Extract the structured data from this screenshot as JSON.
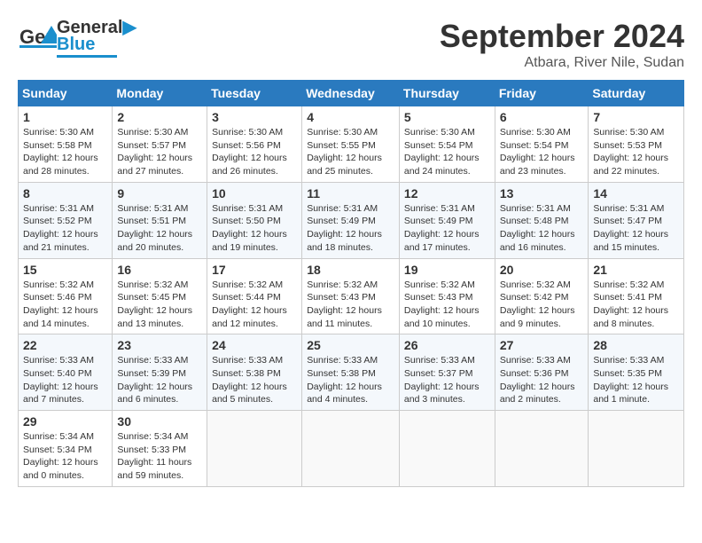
{
  "header": {
    "logo_general": "General",
    "logo_blue": "Blue",
    "month_title": "September 2024",
    "subtitle": "Atbara, River Nile, Sudan"
  },
  "weekdays": [
    "Sunday",
    "Monday",
    "Tuesday",
    "Wednesday",
    "Thursday",
    "Friday",
    "Saturday"
  ],
  "weeks": [
    [
      {
        "day": "1",
        "sunrise": "5:30 AM",
        "sunset": "5:58 PM",
        "daylight": "12 hours and 28 minutes."
      },
      {
        "day": "2",
        "sunrise": "5:30 AM",
        "sunset": "5:57 PM",
        "daylight": "12 hours and 27 minutes."
      },
      {
        "day": "3",
        "sunrise": "5:30 AM",
        "sunset": "5:56 PM",
        "daylight": "12 hours and 26 minutes."
      },
      {
        "day": "4",
        "sunrise": "5:30 AM",
        "sunset": "5:55 PM",
        "daylight": "12 hours and 25 minutes."
      },
      {
        "day": "5",
        "sunrise": "5:30 AM",
        "sunset": "5:54 PM",
        "daylight": "12 hours and 24 minutes."
      },
      {
        "day": "6",
        "sunrise": "5:30 AM",
        "sunset": "5:54 PM",
        "daylight": "12 hours and 23 minutes."
      },
      {
        "day": "7",
        "sunrise": "5:30 AM",
        "sunset": "5:53 PM",
        "daylight": "12 hours and 22 minutes."
      }
    ],
    [
      {
        "day": "8",
        "sunrise": "5:31 AM",
        "sunset": "5:52 PM",
        "daylight": "12 hours and 21 minutes."
      },
      {
        "day": "9",
        "sunrise": "5:31 AM",
        "sunset": "5:51 PM",
        "daylight": "12 hours and 20 minutes."
      },
      {
        "day": "10",
        "sunrise": "5:31 AM",
        "sunset": "5:50 PM",
        "daylight": "12 hours and 19 minutes."
      },
      {
        "day": "11",
        "sunrise": "5:31 AM",
        "sunset": "5:49 PM",
        "daylight": "12 hours and 18 minutes."
      },
      {
        "day": "12",
        "sunrise": "5:31 AM",
        "sunset": "5:49 PM",
        "daylight": "12 hours and 17 minutes."
      },
      {
        "day": "13",
        "sunrise": "5:31 AM",
        "sunset": "5:48 PM",
        "daylight": "12 hours and 16 minutes."
      },
      {
        "day": "14",
        "sunrise": "5:31 AM",
        "sunset": "5:47 PM",
        "daylight": "12 hours and 15 minutes."
      }
    ],
    [
      {
        "day": "15",
        "sunrise": "5:32 AM",
        "sunset": "5:46 PM",
        "daylight": "12 hours and 14 minutes."
      },
      {
        "day": "16",
        "sunrise": "5:32 AM",
        "sunset": "5:45 PM",
        "daylight": "12 hours and 13 minutes."
      },
      {
        "day": "17",
        "sunrise": "5:32 AM",
        "sunset": "5:44 PM",
        "daylight": "12 hours and 12 minutes."
      },
      {
        "day": "18",
        "sunrise": "5:32 AM",
        "sunset": "5:43 PM",
        "daylight": "12 hours and 11 minutes."
      },
      {
        "day": "19",
        "sunrise": "5:32 AM",
        "sunset": "5:43 PM",
        "daylight": "12 hours and 10 minutes."
      },
      {
        "day": "20",
        "sunrise": "5:32 AM",
        "sunset": "5:42 PM",
        "daylight": "12 hours and 9 minutes."
      },
      {
        "day": "21",
        "sunrise": "5:32 AM",
        "sunset": "5:41 PM",
        "daylight": "12 hours and 8 minutes."
      }
    ],
    [
      {
        "day": "22",
        "sunrise": "5:33 AM",
        "sunset": "5:40 PM",
        "daylight": "12 hours and 7 minutes."
      },
      {
        "day": "23",
        "sunrise": "5:33 AM",
        "sunset": "5:39 PM",
        "daylight": "12 hours and 6 minutes."
      },
      {
        "day": "24",
        "sunrise": "5:33 AM",
        "sunset": "5:38 PM",
        "daylight": "12 hours and 5 minutes."
      },
      {
        "day": "25",
        "sunrise": "5:33 AM",
        "sunset": "5:38 PM",
        "daylight": "12 hours and 4 minutes."
      },
      {
        "day": "26",
        "sunrise": "5:33 AM",
        "sunset": "5:37 PM",
        "daylight": "12 hours and 3 minutes."
      },
      {
        "day": "27",
        "sunrise": "5:33 AM",
        "sunset": "5:36 PM",
        "daylight": "12 hours and 2 minutes."
      },
      {
        "day": "28",
        "sunrise": "5:33 AM",
        "sunset": "5:35 PM",
        "daylight": "12 hours and 1 minute."
      }
    ],
    [
      {
        "day": "29",
        "sunrise": "5:34 AM",
        "sunset": "5:34 PM",
        "daylight": "12 hours and 0 minutes."
      },
      {
        "day": "30",
        "sunrise": "5:34 AM",
        "sunset": "5:33 PM",
        "daylight": "11 hours and 59 minutes."
      },
      null,
      null,
      null,
      null,
      null
    ]
  ]
}
